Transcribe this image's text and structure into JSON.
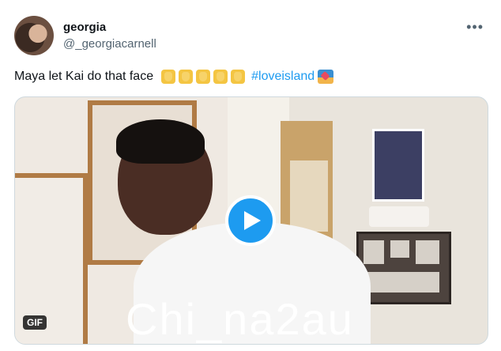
{
  "user": {
    "display_name": "georgia",
    "handle": "@_georgiacarnell",
    "avatar_icon": "profile-photo"
  },
  "header": {
    "more_label": "•••"
  },
  "tweet": {
    "text": "Maya let Kai do that face",
    "emojis": [
      "raised-hand",
      "raised-hand",
      "raised-hand",
      "raised-hand",
      "raised-hand"
    ],
    "hashtag": "#loveisland",
    "hashtag_emoji": "island-flag"
  },
  "media": {
    "badge": "GIF",
    "play_icon": "play-icon",
    "watermark": "Chi_na2au",
    "accent_color": "#1d9bf0"
  }
}
